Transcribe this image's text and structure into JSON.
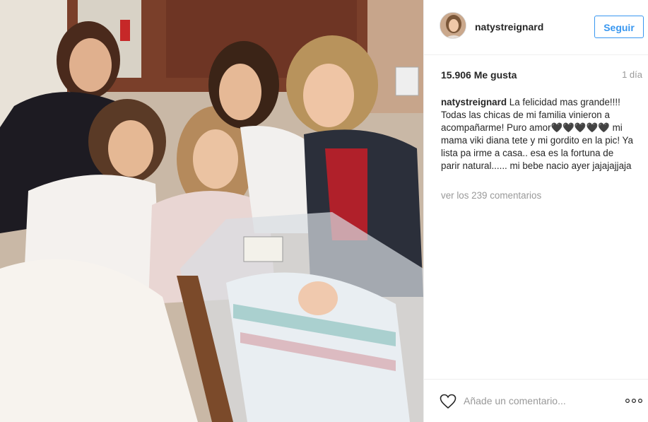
{
  "post": {
    "image_alt": "Foto de cinco mujeres en una habitación de hospital junto a un recién nacido en una cuna"
  },
  "header": {
    "username": "natystreignard",
    "follow_label": "Seguir"
  },
  "stats": {
    "likes": "15.906 Me gusta",
    "time": "1 día"
  },
  "caption": {
    "author": "natystreignard",
    "text": "La felicidad mas grande!!!! Todas las chicas de mi familia vinieron a acompañarme! Puro amor🖤🖤🖤🖤🖤 mi mama viki diana tete y mi gordito en la pic! Ya lista pa irme a casa.. esa es la fortuna de parir natural...... mi bebe nacio ayer jajajajjaja"
  },
  "comments": {
    "view_all": "ver los 239 comentarios"
  },
  "footer": {
    "comment_placeholder": "Añade un comentario..."
  },
  "icons": {
    "like": "heart-outline-icon",
    "more": "more-dots-icon"
  },
  "colors": {
    "accent": "#3897f0",
    "muted": "#999999",
    "text": "#262626"
  }
}
